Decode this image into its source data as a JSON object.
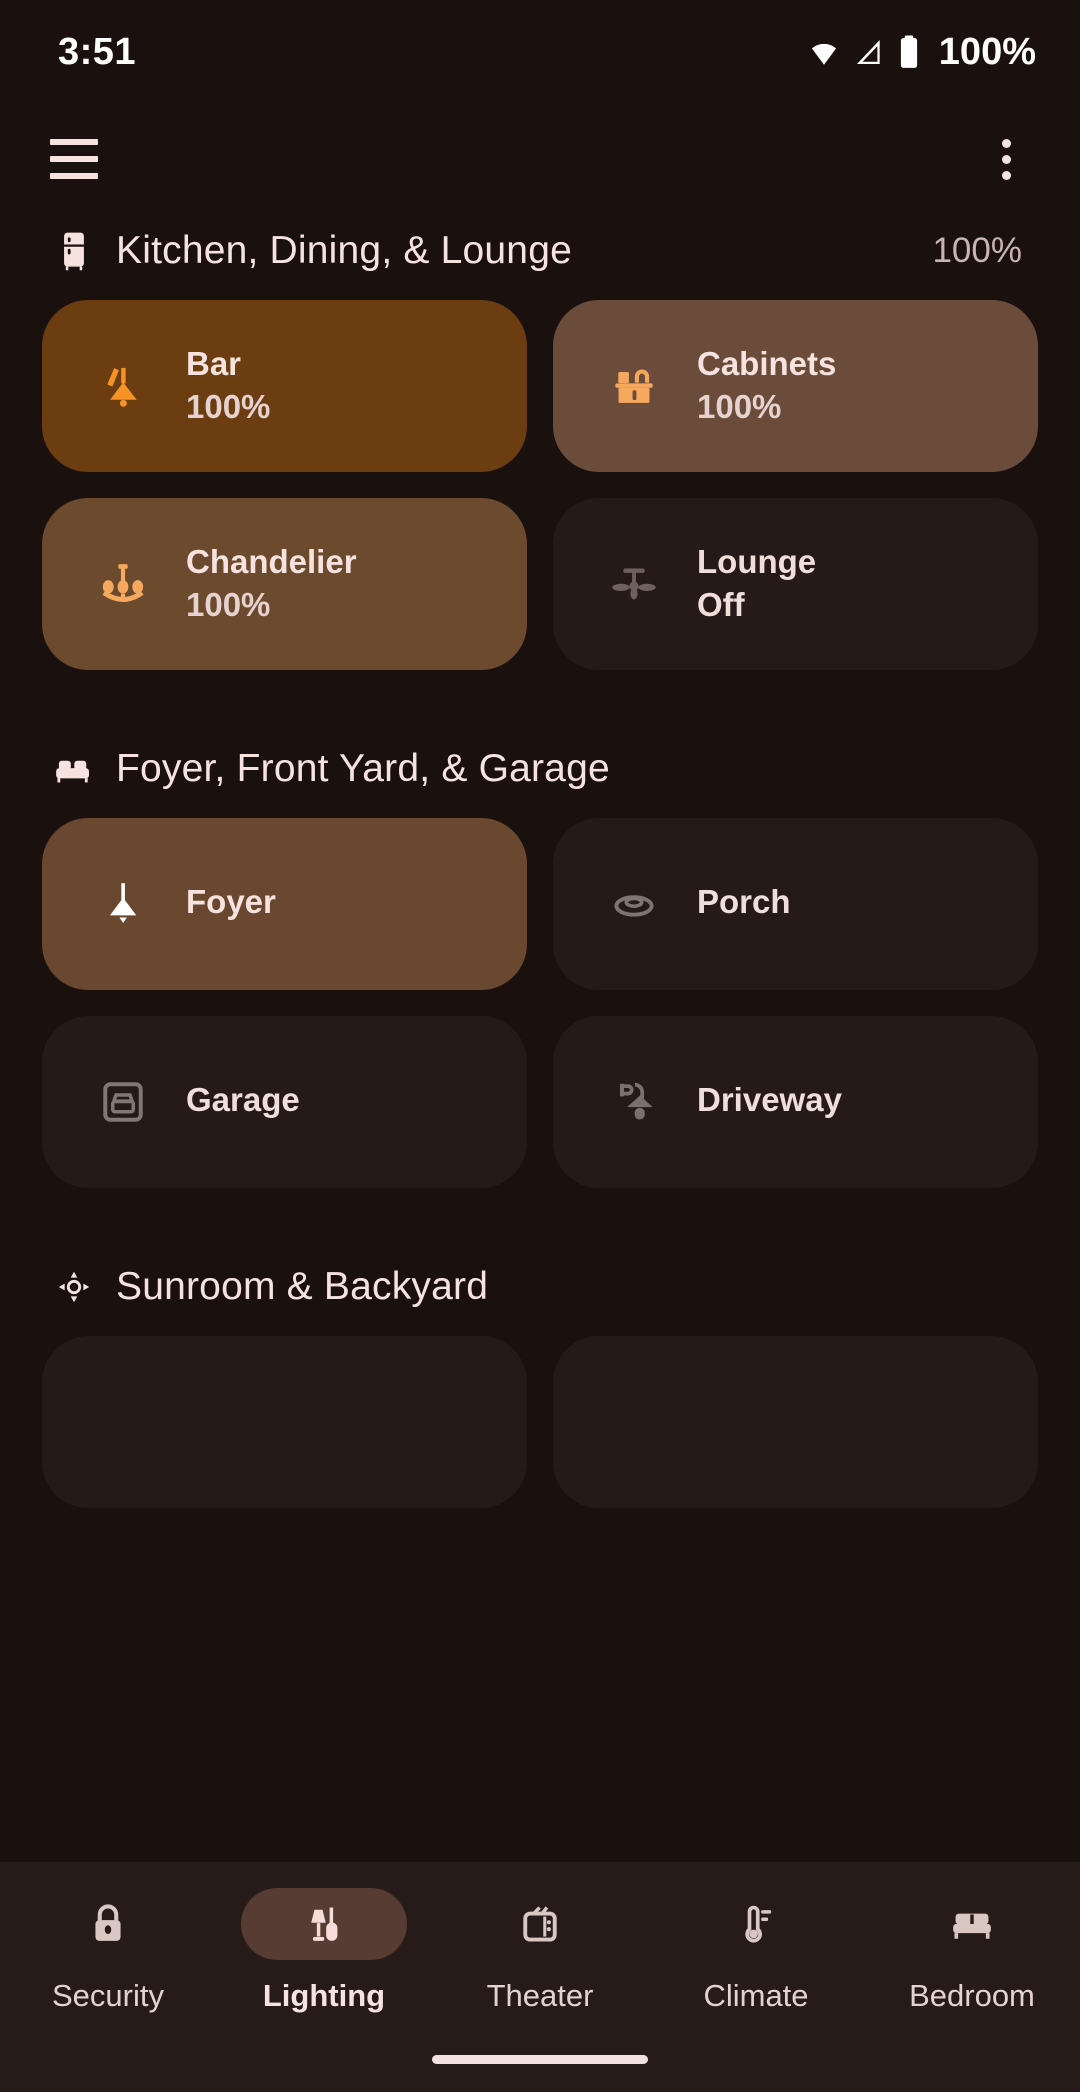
{
  "status_bar": {
    "time": "3:51",
    "battery_percent": "100%",
    "icons": [
      "wifi-icon",
      "cellular-signal-icon",
      "battery-icon"
    ]
  },
  "app_bar": {
    "menu_icon": "hamburger-menu-icon",
    "overflow_icon": "more-vert-icon"
  },
  "colors": {
    "background": "#1a100e",
    "card_off": "#251a17",
    "card_on_strong": "#6b3d10",
    "card_on_mid": "#6b4c3a",
    "accent_orange": "#f59425",
    "accent_orange_light": "#f5a95e",
    "text_primary": "#f6e3e0",
    "text_muted": "#c9b4b0",
    "nav_background": "#261b18",
    "nav_active_pill": "#573c33"
  },
  "sections": [
    {
      "title": "Kitchen, Dining, & Lounge",
      "icon": "refrigerator-icon",
      "percent": "100%",
      "cards": [
        {
          "name": "Bar",
          "state": "100%",
          "icon": "wall-sconce-light-icon",
          "style": "on-strong",
          "on": true
        },
        {
          "name": "Cabinets",
          "state": "100%",
          "icon": "cabinet-light-icon",
          "style": "on-mid",
          "on": true
        },
        {
          "name": "Chandelier",
          "state": "100%",
          "icon": "chandelier-icon",
          "style": "on-warm",
          "on": true
        },
        {
          "name": "Lounge",
          "state": "Off",
          "icon": "ceiling-fan-icon",
          "style": "off",
          "on": false
        }
      ]
    },
    {
      "title": "Foyer, Front Yard, & Garage",
      "icon": "sofa-icon",
      "percent": "",
      "cards": [
        {
          "name": "Foyer",
          "state": "",
          "icon": "pendant-light-icon",
          "style": "on-plain",
          "on": true
        },
        {
          "name": "Porch",
          "state": "",
          "icon": "flush-mount-light-icon",
          "style": "off",
          "on": false
        },
        {
          "name": "Garage",
          "state": "",
          "icon": "garage-door-icon",
          "style": "off",
          "on": false
        },
        {
          "name": "Driveway",
          "state": "",
          "icon": "outdoor-lamp-icon",
          "style": "off",
          "on": false
        }
      ]
    },
    {
      "title": "Sunroom & Backyard",
      "icon": "sun-brightness-icon",
      "percent": "",
      "cards": [
        {
          "name": "",
          "state": "",
          "icon": "",
          "style": "off",
          "on": false
        },
        {
          "name": "",
          "state": "",
          "icon": "",
          "style": "off",
          "on": false
        }
      ]
    }
  ],
  "bottom_nav": {
    "items": [
      {
        "label": "Security",
        "icon": "lock-icon",
        "active": false
      },
      {
        "label": "Lighting",
        "icon": "lamp-icon",
        "active": true
      },
      {
        "label": "Theater",
        "icon": "tv-icon",
        "active": false
      },
      {
        "label": "Climate",
        "icon": "thermometer-icon",
        "active": false
      },
      {
        "label": "Bedroom",
        "icon": "bed-icon",
        "active": false
      }
    ]
  }
}
